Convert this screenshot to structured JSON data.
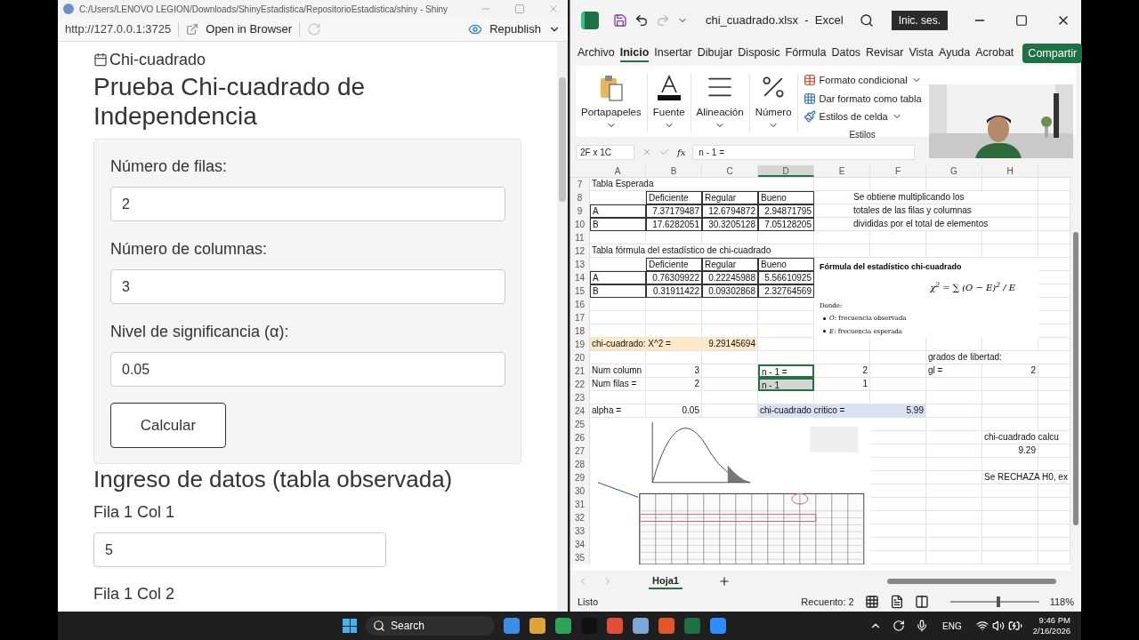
{
  "shiny": {
    "title": "C:/Users/LENOVO LEGION/Downloads/ShinyEstadistica/RepositorioEstadistica/shiny - Shiny",
    "url": "http://127.0.0.1:3725",
    "open_browser": "Open in Browser",
    "republish": "Republish",
    "tab_label": "Chi-cuadrado",
    "heading": "Prueba Chi-cuadrado de Independencia",
    "fields": [
      {
        "label": "Número de filas:",
        "value": "2"
      },
      {
        "label": "Número de columnas:",
        "value": "3"
      },
      {
        "label": "Nivel de significancia (α):",
        "value": "0.05"
      }
    ],
    "button": "Calcular",
    "section": "Ingreso de datos (tabla observada)",
    "data_fields": [
      {
        "label": "Fila 1 Col 1",
        "value": "5"
      },
      {
        "label": "Fila 1 Col 2"
      }
    ]
  },
  "excel": {
    "title": "chi_cuadrado.xlsx  -  Excel",
    "sign_in": "Inic. ses.",
    "tabs": [
      {
        "label": "Archivo",
        "selected": false
      },
      {
        "label": "Inicio",
        "selected": true
      },
      {
        "label": "Insertar",
        "selected": false
      },
      {
        "label": "Dibujar",
        "selected": false
      },
      {
        "label": "Disposic",
        "selected": false
      },
      {
        "label": "Fórmula",
        "selected": false
      },
      {
        "label": "Datos",
        "selected": false
      },
      {
        "label": "Revisar",
        "selected": false
      },
      {
        "label": "Vista",
        "selected": false
      },
      {
        "label": "Ayuda",
        "selected": false
      },
      {
        "label": "Acrobat",
        "selected": false
      }
    ],
    "share": "Compartir",
    "groups": [
      {
        "kind": "clipboard",
        "label": "Portapapeles"
      },
      {
        "kind": "font",
        "label": "Fuente"
      },
      {
        "kind": "align",
        "label": "Alineación"
      },
      {
        "kind": "number",
        "label": "Número"
      }
    ],
    "styles": {
      "items": [
        "Formato condicional",
        "Dar formato como tabla",
        "Estilos de celda"
      ],
      "label": "Estilos"
    },
    "name_box": "2F x 1C",
    "fx": "fx",
    "formula": "n - 1 =",
    "columns": [
      "A",
      "B",
      "C",
      "D",
      "E",
      "F",
      "G",
      "H"
    ],
    "rows": [
      {
        "num": "7",
        "cells": [
          {
            "text": "Tabla Esperada",
            "kind": "text",
            "selected": false
          }
        ]
      },
      {
        "num": "8",
        "cells": [
          "",
          {
            "text": "Deficiente",
            "kind": "text",
            "bordered": true,
            "selected": false
          },
          {
            "text": "Regular",
            "kind": "text",
            "bordered": true,
            "selected": false
          },
          {
            "text": "Bueno",
            "kind": "text",
            "bordered": true,
            "selected": false
          },
          {
            "text": "Se obtiene multiplicando los",
            "kind": "note",
            "selected": false
          }
        ]
      },
      {
        "num": "9",
        "cells": [
          {
            "text": "A",
            "kind": "text",
            "bordered": true,
            "selected": false
          },
          {
            "text": "7.37179487",
            "kind": "number",
            "bordered": true,
            "selected": false
          },
          {
            "text": "12.6794872",
            "kind": "number",
            "bordered": true,
            "selected": false
          },
          {
            "text": "2.94871795",
            "kind": "number",
            "bordered": true,
            "selected": false
          },
          {
            "text": "totales de las filas y columnas",
            "kind": "note",
            "selected": false
          }
        ]
      },
      {
        "num": "10",
        "cells": [
          {
            "text": "B",
            "kind": "text",
            "bordered": true,
            "selected": false
          },
          {
            "text": "17.6282051",
            "kind": "number",
            "bordered": true,
            "selected": false
          },
          {
            "text": "30.3205128",
            "kind": "number",
            "bordered": true,
            "selected": false
          },
          {
            "text": "7.05128205",
            "kind": "number",
            "bordered": true,
            "selected": false
          },
          {
            "text": "divididas por el total de elementos",
            "kind": "note",
            "selected": false
          }
        ]
      },
      {
        "num": "11"
      },
      {
        "num": "12",
        "cells": [
          {
            "text": "Tabla fórmula del estadístico de chi-cuadrado",
            "kind": "text",
            "selected": false
          }
        ]
      },
      {
        "num": "13",
        "cells": [
          "",
          {
            "text": "Deficiente",
            "kind": "text",
            "bordered": true,
            "selected": false
          },
          {
            "text": "Regular",
            "kind": "text",
            "bordered": true,
            "selected": false
          },
          {
            "text": "Bueno",
            "kind": "text",
            "bordered": true,
            "selected": false
          }
        ]
      },
      {
        "num": "14",
        "cells": [
          {
            "text": "A",
            "kind": "text",
            "bordered": true,
            "selected": false
          },
          {
            "text": "0.76309922",
            "kind": "number",
            "bordered": true,
            "selected": false
          },
          {
            "text": "0.22245988",
            "kind": "number",
            "bordered": true,
            "selected": false
          },
          {
            "text": "5.56610925",
            "kind": "number",
            "bordered": true,
            "selected": false
          }
        ]
      },
      {
        "num": "15",
        "cells": [
          {
            "text": "B",
            "kind": "text",
            "bordered": true,
            "selected": false
          },
          {
            "text": "0.31911422",
            "kind": "number",
            "bordered": true,
            "selected": false
          },
          {
            "text": "0.09302868",
            "kind": "number",
            "bordered": true,
            "selected": false
          },
          {
            "text": "2.32764569",
            "kind": "number",
            "bordered": true,
            "selected": false
          }
        ]
      },
      {
        "num": "16"
      },
      {
        "num": "17"
      },
      {
        "num": "18"
      },
      {
        "num": "19",
        "cells": [
          {
            "text": "chi-cuadrado: X^2 =",
            "kind": "text",
            "color": "#fde9c7",
            "selected": false
          },
          "",
          {
            "text": "9.29145694",
            "kind": "number",
            "color": "#fde9c7",
            "selected": false
          }
        ]
      },
      {
        "num": "20",
        "cells": [
          "",
          "",
          "",
          "",
          "",
          "",
          {
            "text": "grados de libertad:",
            "kind": "text",
            "selected": false
          }
        ]
      },
      {
        "num": "21",
        "cells": [
          {
            "text": "Num column",
            "kind": "text",
            "selected": false
          },
          {
            "text": "3",
            "kind": "number",
            "selected": false
          },
          "",
          {
            "text": "n - 1 =",
            "kind": "text",
            "selected": true
          },
          {
            "text": "2",
            "kind": "number",
            "selected": false
          },
          "",
          {
            "text": "gl =",
            "kind": "text",
            "selected": false
          },
          {
            "text": "2",
            "kind": "number",
            "selected": false
          }
        ]
      },
      {
        "num": "22",
        "cells": [
          {
            "text": "Num filas =",
            "kind": "text",
            "selected": false
          },
          {
            "text": "2",
            "kind": "number",
            "selected": false
          },
          "",
          {
            "text": "n - 1",
            "kind": "text",
            "selected": true
          },
          {
            "text": "1",
            "kind": "number",
            "selected": false
          }
        ]
      },
      {
        "num": "23"
      },
      {
        "num": "24",
        "cells": [
          {
            "text": "alpha =",
            "kind": "text",
            "selected": false
          },
          {
            "text": "0.05",
            "kind": "number",
            "selected": false
          },
          "",
          {
            "text": "chi-cuadrado critico =",
            "kind": "text",
            "color": "#d9e1f2",
            "selected": false
          },
          "",
          {
            "text": "5.99",
            "kind": "number",
            "color": "#d9e1f2",
            "selected": false
          }
        ]
      },
      {
        "num": "25"
      },
      {
        "num": "26",
        "cells": [
          "",
          "",
          "",
          "",
          "",
          "",
          "",
          {
            "text": "chi-cuadrado calcu",
            "kind": "text",
            "selected": false
          }
        ]
      },
      {
        "num": "27",
        "cells": [
          "",
          "",
          "",
          "",
          "",
          "",
          "",
          {
            "text": "9.29",
            "kind": "number",
            "selected": false
          }
        ]
      },
      {
        "num": "28"
      },
      {
        "num": "29",
        "cells": [
          "",
          "",
          "",
          "",
          "",
          "",
          "",
          {
            "text": "Se RECHAZA H0, ex",
            "kind": "text",
            "selected": false
          }
        ]
      },
      {
        "num": "30"
      },
      {
        "num": "31"
      },
      {
        "num": "32"
      },
      {
        "num": "33"
      },
      {
        "num": "34"
      },
      {
        "num": "35"
      }
    ],
    "formula_image": {
      "title": "Fórmula del estadístico chi-cuadrado",
      "formula": "χ$^{2}$ = ∑ (O − E)$^{2}$ / E",
      "where": "Donde:",
      "bullets": [
        "*O*: frecuencia observada",
        "*E*: frecuencia esperada"
      ]
    },
    "sheet_tab": "Hoja1",
    "status": "Listo",
    "count": "Recuento: 2",
    "zoom": {
      "text": "118%",
      "level": 0.55
    }
  },
  "taskbar": {
    "search": "Search",
    "lang": "ENG",
    "time": "9:46 PM",
    "date": "2/16/2026"
  }
}
